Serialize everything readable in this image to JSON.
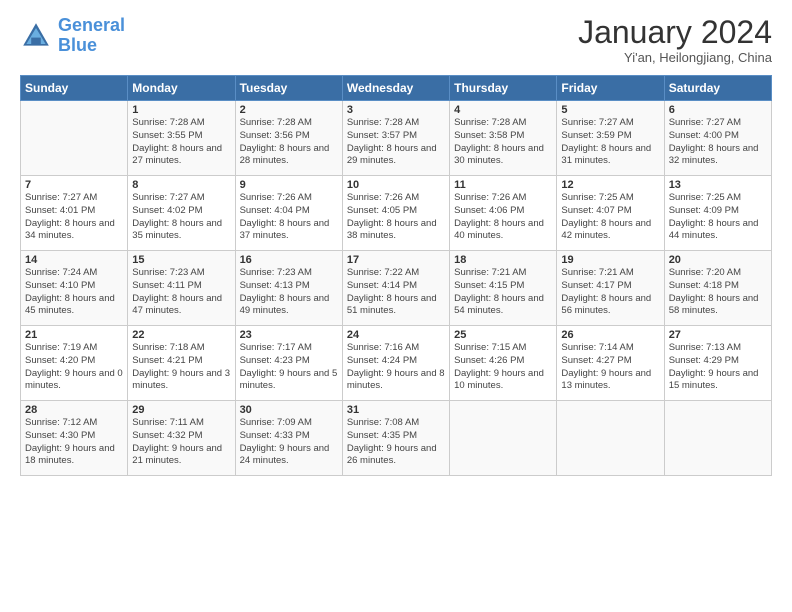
{
  "logo": {
    "line1": "General",
    "line2": "Blue"
  },
  "title": "January 2024",
  "subtitle": "Yi'an, Heilongjiang, China",
  "headers": [
    "Sunday",
    "Monday",
    "Tuesday",
    "Wednesday",
    "Thursday",
    "Friday",
    "Saturday"
  ],
  "weeks": [
    [
      {
        "day": "",
        "sunrise": "",
        "sunset": "",
        "daylight": ""
      },
      {
        "day": "1",
        "sunrise": "Sunrise: 7:28 AM",
        "sunset": "Sunset: 3:55 PM",
        "daylight": "Daylight: 8 hours and 27 minutes."
      },
      {
        "day": "2",
        "sunrise": "Sunrise: 7:28 AM",
        "sunset": "Sunset: 3:56 PM",
        "daylight": "Daylight: 8 hours and 28 minutes."
      },
      {
        "day": "3",
        "sunrise": "Sunrise: 7:28 AM",
        "sunset": "Sunset: 3:57 PM",
        "daylight": "Daylight: 8 hours and 29 minutes."
      },
      {
        "day": "4",
        "sunrise": "Sunrise: 7:28 AM",
        "sunset": "Sunset: 3:58 PM",
        "daylight": "Daylight: 8 hours and 30 minutes."
      },
      {
        "day": "5",
        "sunrise": "Sunrise: 7:27 AM",
        "sunset": "Sunset: 3:59 PM",
        "daylight": "Daylight: 8 hours and 31 minutes."
      },
      {
        "day": "6",
        "sunrise": "Sunrise: 7:27 AM",
        "sunset": "Sunset: 4:00 PM",
        "daylight": "Daylight: 8 hours and 32 minutes."
      }
    ],
    [
      {
        "day": "7",
        "sunrise": "Sunrise: 7:27 AM",
        "sunset": "Sunset: 4:01 PM",
        "daylight": "Daylight: 8 hours and 34 minutes."
      },
      {
        "day": "8",
        "sunrise": "Sunrise: 7:27 AM",
        "sunset": "Sunset: 4:02 PM",
        "daylight": "Daylight: 8 hours and 35 minutes."
      },
      {
        "day": "9",
        "sunrise": "Sunrise: 7:26 AM",
        "sunset": "Sunset: 4:04 PM",
        "daylight": "Daylight: 8 hours and 37 minutes."
      },
      {
        "day": "10",
        "sunrise": "Sunrise: 7:26 AM",
        "sunset": "Sunset: 4:05 PM",
        "daylight": "Daylight: 8 hours and 38 minutes."
      },
      {
        "day": "11",
        "sunrise": "Sunrise: 7:26 AM",
        "sunset": "Sunset: 4:06 PM",
        "daylight": "Daylight: 8 hours and 40 minutes."
      },
      {
        "day": "12",
        "sunrise": "Sunrise: 7:25 AM",
        "sunset": "Sunset: 4:07 PM",
        "daylight": "Daylight: 8 hours and 42 minutes."
      },
      {
        "day": "13",
        "sunrise": "Sunrise: 7:25 AM",
        "sunset": "Sunset: 4:09 PM",
        "daylight": "Daylight: 8 hours and 44 minutes."
      }
    ],
    [
      {
        "day": "14",
        "sunrise": "Sunrise: 7:24 AM",
        "sunset": "Sunset: 4:10 PM",
        "daylight": "Daylight: 8 hours and 45 minutes."
      },
      {
        "day": "15",
        "sunrise": "Sunrise: 7:23 AM",
        "sunset": "Sunset: 4:11 PM",
        "daylight": "Daylight: 8 hours and 47 minutes."
      },
      {
        "day": "16",
        "sunrise": "Sunrise: 7:23 AM",
        "sunset": "Sunset: 4:13 PM",
        "daylight": "Daylight: 8 hours and 49 minutes."
      },
      {
        "day": "17",
        "sunrise": "Sunrise: 7:22 AM",
        "sunset": "Sunset: 4:14 PM",
        "daylight": "Daylight: 8 hours and 51 minutes."
      },
      {
        "day": "18",
        "sunrise": "Sunrise: 7:21 AM",
        "sunset": "Sunset: 4:15 PM",
        "daylight": "Daylight: 8 hours and 54 minutes."
      },
      {
        "day": "19",
        "sunrise": "Sunrise: 7:21 AM",
        "sunset": "Sunset: 4:17 PM",
        "daylight": "Daylight: 8 hours and 56 minutes."
      },
      {
        "day": "20",
        "sunrise": "Sunrise: 7:20 AM",
        "sunset": "Sunset: 4:18 PM",
        "daylight": "Daylight: 8 hours and 58 minutes."
      }
    ],
    [
      {
        "day": "21",
        "sunrise": "Sunrise: 7:19 AM",
        "sunset": "Sunset: 4:20 PM",
        "daylight": "Daylight: 9 hours and 0 minutes."
      },
      {
        "day": "22",
        "sunrise": "Sunrise: 7:18 AM",
        "sunset": "Sunset: 4:21 PM",
        "daylight": "Daylight: 9 hours and 3 minutes."
      },
      {
        "day": "23",
        "sunrise": "Sunrise: 7:17 AM",
        "sunset": "Sunset: 4:23 PM",
        "daylight": "Daylight: 9 hours and 5 minutes."
      },
      {
        "day": "24",
        "sunrise": "Sunrise: 7:16 AM",
        "sunset": "Sunset: 4:24 PM",
        "daylight": "Daylight: 9 hours and 8 minutes."
      },
      {
        "day": "25",
        "sunrise": "Sunrise: 7:15 AM",
        "sunset": "Sunset: 4:26 PM",
        "daylight": "Daylight: 9 hours and 10 minutes."
      },
      {
        "day": "26",
        "sunrise": "Sunrise: 7:14 AM",
        "sunset": "Sunset: 4:27 PM",
        "daylight": "Daylight: 9 hours and 13 minutes."
      },
      {
        "day": "27",
        "sunrise": "Sunrise: 7:13 AM",
        "sunset": "Sunset: 4:29 PM",
        "daylight": "Daylight: 9 hours and 15 minutes."
      }
    ],
    [
      {
        "day": "28",
        "sunrise": "Sunrise: 7:12 AM",
        "sunset": "Sunset: 4:30 PM",
        "daylight": "Daylight: 9 hours and 18 minutes."
      },
      {
        "day": "29",
        "sunrise": "Sunrise: 7:11 AM",
        "sunset": "Sunset: 4:32 PM",
        "daylight": "Daylight: 9 hours and 21 minutes."
      },
      {
        "day": "30",
        "sunrise": "Sunrise: 7:09 AM",
        "sunset": "Sunset: 4:33 PM",
        "daylight": "Daylight: 9 hours and 24 minutes."
      },
      {
        "day": "31",
        "sunrise": "Sunrise: 7:08 AM",
        "sunset": "Sunset: 4:35 PM",
        "daylight": "Daylight: 9 hours and 26 minutes."
      },
      {
        "day": "",
        "sunrise": "",
        "sunset": "",
        "daylight": ""
      },
      {
        "day": "",
        "sunrise": "",
        "sunset": "",
        "daylight": ""
      },
      {
        "day": "",
        "sunrise": "",
        "sunset": "",
        "daylight": ""
      }
    ]
  ]
}
